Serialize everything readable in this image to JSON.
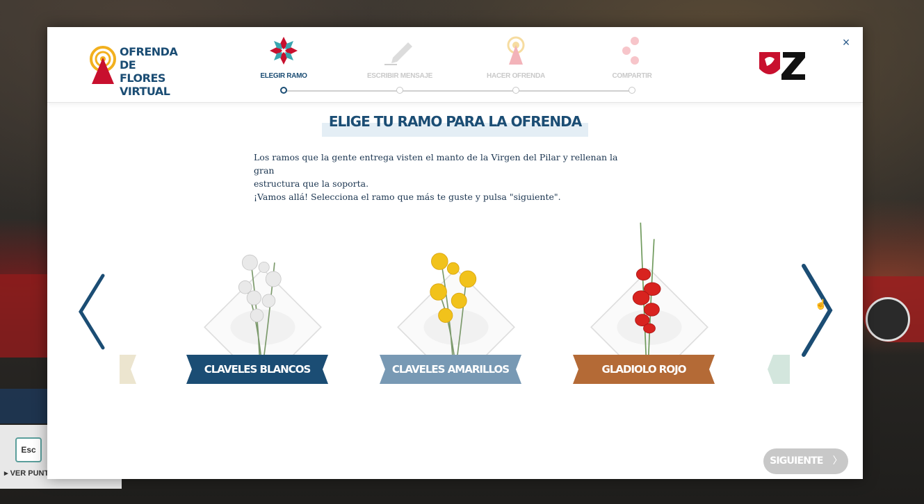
{
  "background": {
    "esc_key": "Esc",
    "esc_hint": "VER PUNTER"
  },
  "header": {
    "logo_text": [
      "OFRENDA",
      "DE FLORES",
      "VIRTUAL"
    ],
    "steps": [
      {
        "label": "ELEGIR RAMO",
        "icon": "flower-icon",
        "state": "active"
      },
      {
        "label": "ESCRIBIR MENSAJE",
        "icon": "pencil-icon",
        "state": "pending"
      },
      {
        "label": "HACER OFRENDA",
        "icon": "virgin-icon",
        "state": "pending"
      },
      {
        "label": "COMPARTIR",
        "icon": "share-icon",
        "state": "pending"
      }
    ],
    "close_label": "×"
  },
  "main": {
    "title": "ELIGE TU RAMO PARA LA OFRENDA",
    "intro_line1": "Los ramos que la gente entrega visten el manto de la Virgen del Pilar y rellenan la gran",
    "intro_line2": "estructura que la soporta.",
    "intro_line3": "¡Vamos allá! Selecciona el ramo que más te guste y pulsa \"siguiente\".",
    "bouquets": [
      {
        "name": "CLAVELES BLANCOS",
        "ribbon_color": "#1b4d74"
      },
      {
        "name": "CLAVELES AMARILLOS",
        "ribbon_color": "#7899b4"
      },
      {
        "name": "GLADIOLO ROJO",
        "ribbon_color": "#b46a36"
      }
    ]
  },
  "footer": {
    "next_label": "SIGUIENTE",
    "next_chevron": "〉"
  },
  "colors": {
    "primary": "#1b4d74",
    "accent_red": "#c8102e",
    "disabled": "#c8c8c8"
  }
}
